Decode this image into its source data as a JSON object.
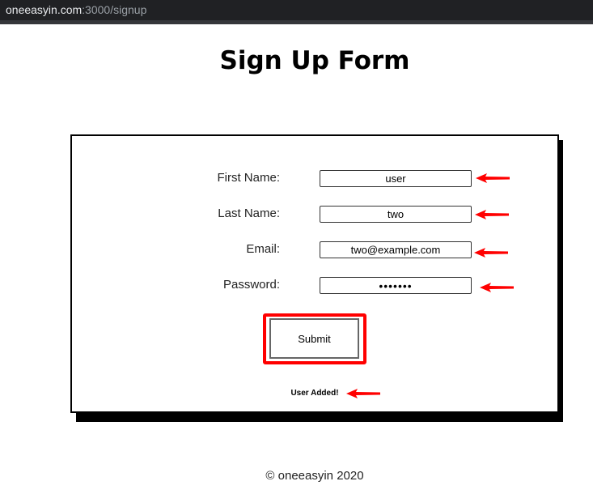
{
  "browser": {
    "url_host": "oneeasyin.com",
    "url_rest": ":3000/signup"
  },
  "page": {
    "title": "Sign Up Form",
    "footer": "© oneeasyin 2020"
  },
  "form": {
    "first_name": {
      "label": "First Name:",
      "value": "user"
    },
    "last_name": {
      "label": "Last Name:",
      "value": "two"
    },
    "email": {
      "label": "Email:",
      "value": "two@example.com"
    },
    "password": {
      "label": "Password:",
      "value": "•••••••"
    },
    "submit_label": "Submit",
    "status_message": "User Added!"
  },
  "annotations": {
    "color": "#ff0000",
    "icon": "left-arrow-icon"
  }
}
